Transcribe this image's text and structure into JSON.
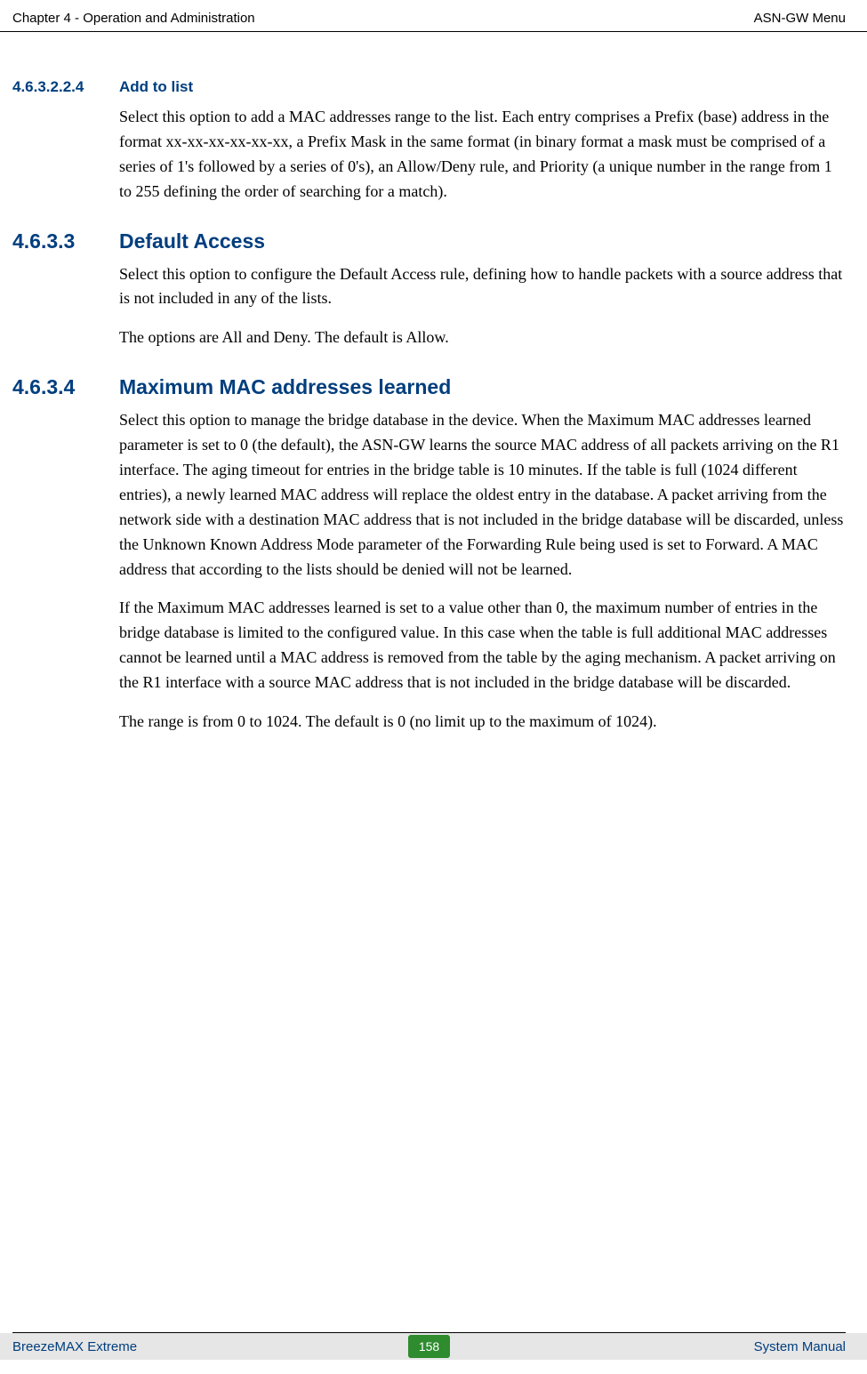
{
  "header": {
    "left": "Chapter 4 - Operation and Administration",
    "right": "ASN-GW Menu"
  },
  "sections": {
    "s1": {
      "num": "4.6.3.2.2.4",
      "title": "Add to list",
      "para1": "Select this option to add a MAC addresses range to the list. Each entry comprises a Prefix (base) address in the format xx-xx-xx-xx-xx-xx, a Prefix Mask in the same format (in binary format a mask must be comprised of a series of 1's followed by a series of 0's), an Allow/Deny rule, and Priority (a unique number in the range from 1 to 255 defining the order of searching for a match)."
    },
    "s2": {
      "num": "4.6.3.3",
      "title": "Default Access",
      "para1": "Select this option to configure the Default Access rule, defining how to handle packets with a source address that is not included in any of the lists.",
      "para2": "The options are All and Deny. The default is Allow."
    },
    "s3": {
      "num": "4.6.3.4",
      "title": "Maximum MAC addresses learned",
      "para1": "Select this option to manage the bridge database in the device. When the Maximum MAC addresses learned parameter is set to 0 (the default), the ASN-GW learns the source MAC address of all packets arriving on the R1 interface. The aging timeout for entries in the bridge table is 10 minutes. If the table is full (1024 different entries), a newly learned MAC address will replace the oldest entry in the database. A packet arriving from the network side with a destination MAC address that is not included in the bridge database will be discarded, unless the Unknown Known Address Mode parameter of the Forwarding Rule being used is set to Forward. A MAC address that according to the lists should be denied will not be learned.",
      "para2": "If the Maximum MAC addresses learned is set to a value other than 0, the maximum number of entries in the bridge database is limited to the configured value. In this case when the table is full additional MAC addresses cannot be learned until a MAC address is removed from the table by the aging mechanism. A packet arriving on the R1 interface with a source MAC address that is not included in the bridge database will be discarded.",
      "para3": "The range is from 0 to 1024. The default is 0 (no limit up to the maximum of 1024)."
    }
  },
  "footer": {
    "left": "BreezeMAX Extreme",
    "page": "158",
    "right": "System Manual"
  }
}
